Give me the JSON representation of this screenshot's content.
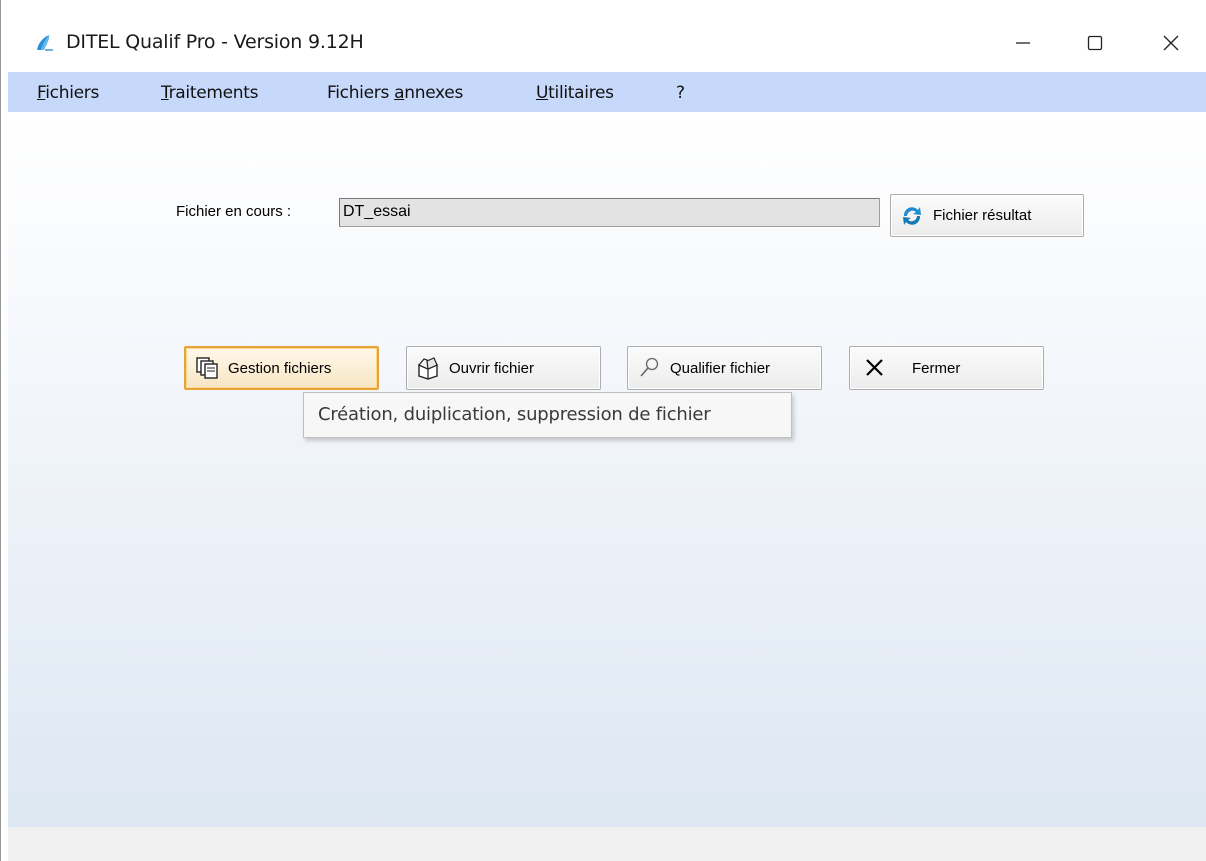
{
  "window": {
    "title": "DITEL Qualif Pro - Version 9.12H",
    "icon": "ditel-app-icon",
    "controls": {
      "minimize": "minimize-icon",
      "maximize": "maximize-icon",
      "close": "close-icon"
    }
  },
  "menu": {
    "items": [
      {
        "pre": "",
        "ul": "F",
        "post": "ichiers"
      },
      {
        "pre": "",
        "ul": "T",
        "post": "raitements"
      },
      {
        "pre": "Fichiers ",
        "ul": "a",
        "post": "nnexes"
      },
      {
        "pre": "",
        "ul": "U",
        "post": "tilitaires"
      },
      {
        "pre": "?",
        "ul": "",
        "post": ""
      }
    ]
  },
  "file": {
    "label": "Fichier en cours :",
    "value": "DT_essai",
    "result_button": "Fichier résultat"
  },
  "actions": {
    "gestion": "Gestion fichiers",
    "ouvrir": "Ouvrir fichier",
    "qualifier": "Qualifier fichier",
    "fermer": "Fermer"
  },
  "tooltip": {
    "text": "Création, duiplication, suppression de fichier"
  },
  "colors": {
    "menubar": "#c7d9fb",
    "focus_border": "#e6a23c",
    "client_gradient_end": "#dde7f2"
  }
}
